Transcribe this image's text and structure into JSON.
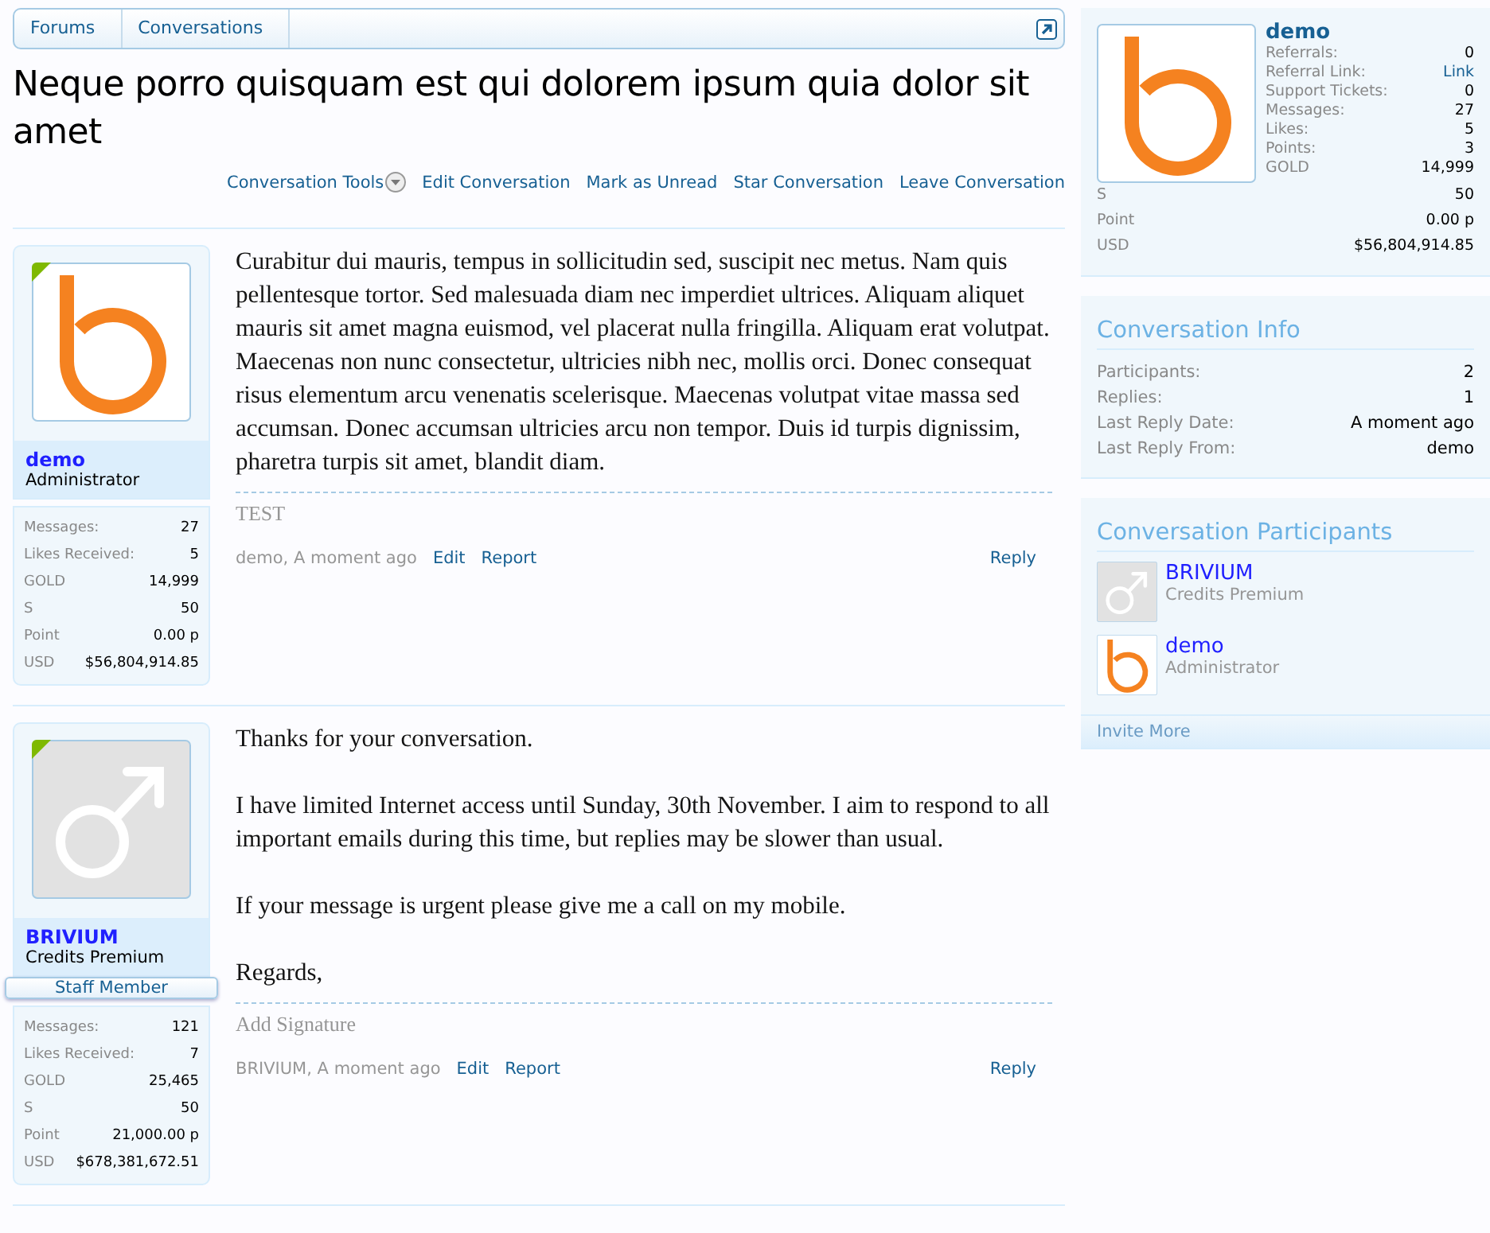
{
  "breadcrumb": [
    "Forums",
    "Conversations"
  ],
  "title": "Neque porro quisquam est qui dolorem ipsum quia dolor sit amet",
  "tools": [
    {
      "label": "Conversation Tools",
      "kind": "menu"
    },
    {
      "label": "Edit Conversation",
      "kind": "link"
    },
    {
      "label": "Mark as Unread",
      "kind": "link"
    },
    {
      "label": "Star Conversation",
      "kind": "link"
    },
    {
      "label": "Leave Conversation",
      "kind": "link"
    }
  ],
  "messages": [
    {
      "avatar": {
        "kind": "b-logo"
      },
      "online": true,
      "username": "demo",
      "user_title": "Administrator",
      "stats": [
        {
          "label": "Messages:",
          "value": "27"
        },
        {
          "label": "Likes Received:",
          "value": "5"
        },
        {
          "label": "GOLD",
          "value": "14,999"
        },
        {
          "label": "S",
          "value": "50"
        },
        {
          "label": "Point",
          "value": "0.00 p"
        },
        {
          "label": "USD",
          "value": "$56,804,914.85"
        }
      ],
      "paragraphs": [
        "Curabitur dui mauris, tempus in sollicitudin sed, suscipit nec metus. Nam quis pellentesque tortor. Sed malesuada diam nec imperdiet ultrices. Aliquam aliquet mauris sit amet magna euismod, vel placerat nulla fringilla. Aliquam erat volutpat. Maecenas non nunc consectetur, ultricies nibh nec, mollis orci. Donec consequat risus elementum arcu venenatis scelerisque. Maecenas volutpat vitae massa sed accumsan. Donec accumsan ultricies arcu non tempor. Duis id turpis dignissim, pharetra turpis sit amet, blandit diam."
      ],
      "signature": "TEST",
      "meta": "demo, A moment ago",
      "actions": [
        "Edit",
        "Report"
      ],
      "reply": "Reply"
    },
    {
      "avatar": {
        "kind": "male-default"
      },
      "online": true,
      "username": "BRIVIUM",
      "user_title": "Credits Premium",
      "staff_badge": "Staff Member",
      "stats": [
        {
          "label": "Messages:",
          "value": "121"
        },
        {
          "label": "Likes Received:",
          "value": "7"
        },
        {
          "label": "GOLD",
          "value": "25,465"
        },
        {
          "label": "S",
          "value": "50"
        },
        {
          "label": "Point",
          "value": "21,000.00 p"
        },
        {
          "label": "USD",
          "value": "$678,381,672.51"
        }
      ],
      "paragraphs": [
        "Thanks for your conversation.",
        "I have limited Internet access until Sunday, 30th November. I aim to respond to all important emails during this time, but replies may be slower than usual.",
        "If your message is urgent please give me a call on my mobile.",
        "Regards,"
      ],
      "signature": "Add Signature",
      "meta": "BRIVIUM, A moment ago",
      "actions": [
        "Edit",
        "Report"
      ],
      "reply": "Reply"
    }
  ],
  "sidebar": {
    "profile": {
      "avatar": {
        "kind": "b-logo"
      },
      "username": "demo",
      "stats": [
        {
          "label": "Referrals:",
          "value": "0"
        },
        {
          "label": "Referral Link:",
          "value": "Link",
          "kind": "link"
        },
        {
          "label": "Support Tickets:",
          "value": "0"
        },
        {
          "label": "Messages:",
          "value": "27"
        },
        {
          "label": "Likes:",
          "value": "5"
        },
        {
          "label": "Points:",
          "value": "3"
        },
        {
          "label": "GOLD",
          "value": "14,999"
        }
      ],
      "extra_stats": [
        {
          "label": "S",
          "value": "50"
        },
        {
          "label": "Point",
          "value": "0.00 p"
        },
        {
          "label": "USD",
          "value": "$56,804,914.85"
        }
      ]
    },
    "info": {
      "heading": "Conversation Info",
      "rows": [
        {
          "label": "Participants:",
          "value": "2"
        },
        {
          "label": "Replies:",
          "value": "1"
        },
        {
          "label": "Last Reply Date:",
          "value": "A moment ago"
        },
        {
          "label": "Last Reply From:",
          "value": "demo"
        }
      ]
    },
    "participants": {
      "heading": "Conversation Participants",
      "items": [
        {
          "avatar": {
            "kind": "male-default"
          },
          "name": "BRIVIUM",
          "title": "Credits Premium"
        },
        {
          "avatar": {
            "kind": "b-logo"
          },
          "name": "demo",
          "title": "Administrator"
        }
      ],
      "footer": "Invite More"
    }
  }
}
